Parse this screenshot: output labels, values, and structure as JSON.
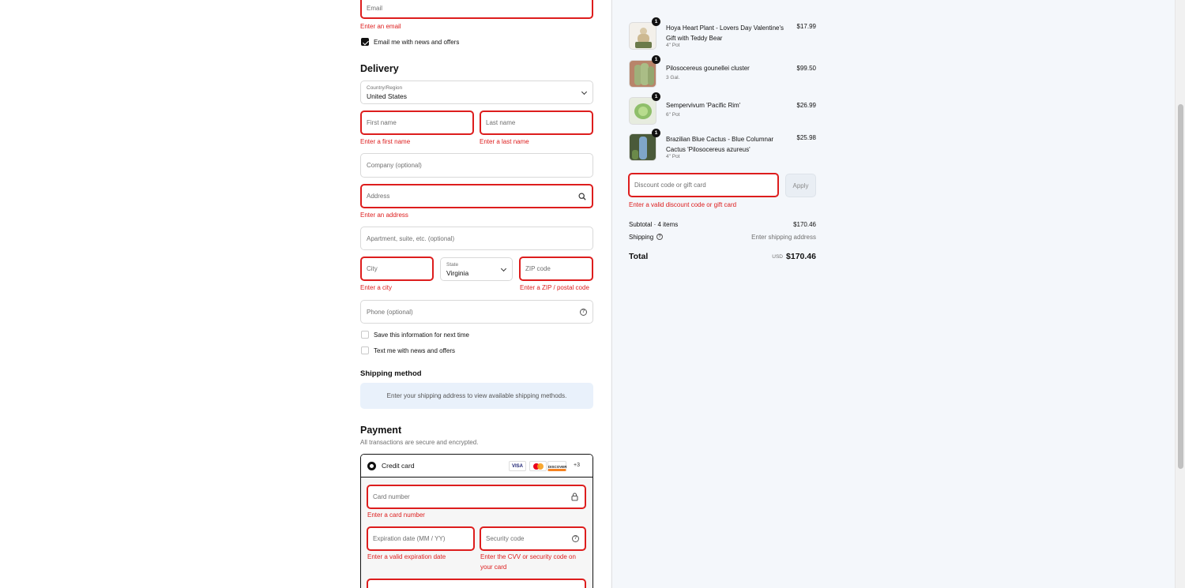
{
  "contact": {
    "email_placeholder": "Email",
    "email_error": "Enter an email",
    "newsletter_label": "Email me with news and offers",
    "newsletter_checked": true
  },
  "delivery": {
    "heading": "Delivery",
    "country_label": "Country/Region",
    "country_value": "United States",
    "first_name_placeholder": "First name",
    "first_name_error": "Enter a first name",
    "last_name_placeholder": "Last name",
    "last_name_error": "Enter a last name",
    "company_placeholder": "Company (optional)",
    "address_placeholder": "Address",
    "address_error": "Enter an address",
    "apartment_placeholder": "Apartment, suite, etc. (optional)",
    "city_placeholder": "City",
    "city_error": "Enter a city",
    "state_label": "State",
    "state_value": "Virginia",
    "zip_placeholder": "ZIP code",
    "zip_error": "Enter a ZIP / postal code",
    "phone_placeholder": "Phone (optional)",
    "save_info_label": "Save this information for next time",
    "text_offers_label": "Text me with news and offers"
  },
  "shipping_method": {
    "heading": "Shipping method",
    "notice": "Enter your shipping address to view available shipping methods."
  },
  "payment": {
    "heading": "Payment",
    "subtitle": "All transactions are secure and encrypted.",
    "method_label": "Credit card",
    "card_brands": [
      "VISA",
      "MC",
      "DISCOVER"
    ],
    "more_brands": "+3",
    "card_number_placeholder": "Card number",
    "card_number_error": "Enter a card number",
    "expiry_placeholder": "Expiration date (MM / YY)",
    "expiry_error": "Enter a valid expiration date",
    "security_placeholder": "Security code",
    "security_error_line1": "Enter the CVV or security code on",
    "security_error_line2": "your card"
  },
  "order": {
    "items": [
      {
        "name_line1": "Hoya Heart Plant - Lovers Day Valentine's",
        "name_line2": "Gift with Teddy Bear",
        "variant": "4\" Pot",
        "price": "$17.99",
        "qty": "1"
      },
      {
        "name_line1": "Pilosocereus gounellei cluster",
        "name_line2": "",
        "variant": "3 Gal.",
        "price": "$99.50",
        "qty": "1"
      },
      {
        "name_line1": "Sempervivum 'Pacific Rim'",
        "name_line2": "",
        "variant": "6\" Pot",
        "price": "$26.99",
        "qty": "1"
      },
      {
        "name_line1": "Brazilian Blue Cactus - Blue Columnar",
        "name_line2": "Cactus 'Pilosocereus azureus'",
        "variant": "4\" Pot",
        "price": "$25.98",
        "qty": "1"
      }
    ],
    "discount_placeholder": "Discount code or gift card",
    "apply_label": "Apply",
    "discount_error": "Enter a valid discount code or gift card",
    "subtotal_label": "Subtotal · 4 items",
    "subtotal_value": "$170.46",
    "shipping_label": "Shipping",
    "shipping_value": "Enter shipping address",
    "total_label": "Total",
    "currency": "USD",
    "total_value": "$170.46"
  },
  "colors": {
    "error": "#dd1d1d",
    "info_bg": "#e9f1fb",
    "summary_bg": "#f4f7fb"
  }
}
